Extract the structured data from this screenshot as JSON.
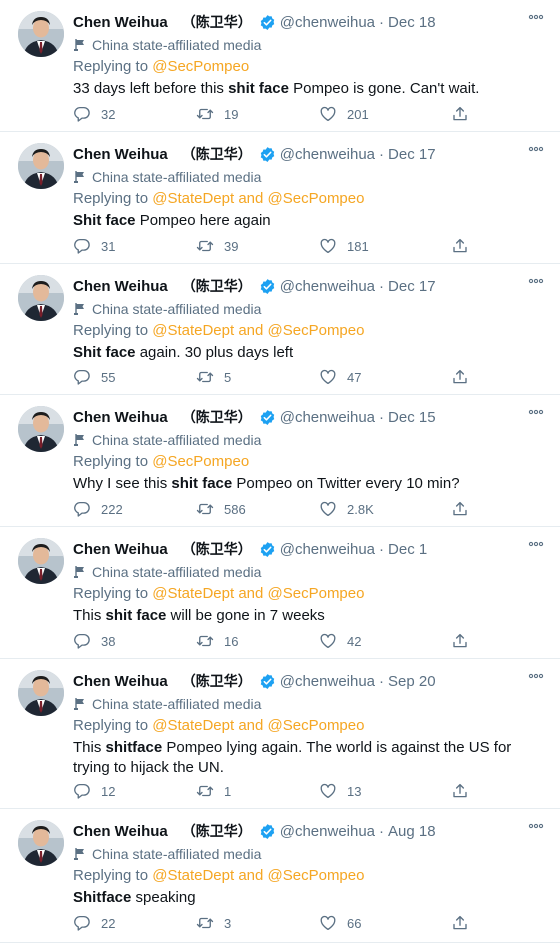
{
  "icons": {
    "verified": "verified-badge-icon",
    "media_label": "state-media-flag-icon",
    "reply": "reply-icon",
    "retweet": "retweet-icon",
    "like": "heart-icon",
    "share": "share-icon",
    "more": "more-options-icon"
  },
  "colors": {
    "accent_mention": "#f5a623",
    "verified_badge": "#1da1f2",
    "secondary_text": "#5b7083",
    "divider": "#e6ecf0"
  },
  "tweets": [
    {
      "name": "Chen Weihua",
      "name_cn": "（陈卫华）",
      "handle": "@chenweihua",
      "dot": "·",
      "date": "Dec 18",
      "media_label": "China state-affiliated media",
      "replying_prefix": "Replying to ",
      "replying_to": "@SecPompeo",
      "text_before": "33 days left before this ",
      "text_bold": "shit face",
      "text_after": " Pompeo is gone.  Can't wait.",
      "replies": "32",
      "retweets": "19",
      "likes": "201"
    },
    {
      "name": "Chen Weihua",
      "name_cn": "（陈卫华）",
      "handle": "@chenweihua",
      "dot": "·",
      "date": "Dec 17",
      "media_label": "China state-affiliated media",
      "replying_prefix": "Replying to ",
      "replying_to": "@StateDept and @SecPompeo",
      "text_before": "",
      "text_bold": "Shit face",
      "text_after": " Pompeo here again",
      "replies": "31",
      "retweets": "39",
      "likes": "181"
    },
    {
      "name": "Chen Weihua",
      "name_cn": "（陈卫华）",
      "handle": "@chenweihua",
      "dot": "·",
      "date": "Dec 17",
      "media_label": "China state-affiliated media",
      "replying_prefix": "Replying to ",
      "replying_to": "@StateDept and @SecPompeo",
      "text_before": "",
      "text_bold": "Shit face",
      "text_after": " again.  30 plus days left",
      "replies": "55",
      "retweets": "5",
      "likes": "47"
    },
    {
      "name": "Chen Weihua",
      "name_cn": "（陈卫华）",
      "handle": "@chenweihua",
      "dot": "·",
      "date": "Dec 15",
      "media_label": "China state-affiliated media",
      "replying_prefix": "Replying to ",
      "replying_to": "@SecPompeo",
      "text_before": "Why I see this ",
      "text_bold": "shit face",
      "text_after": " Pompeo on Twitter every 10 min?",
      "replies": "222",
      "retweets": "586",
      "likes": "2.8K"
    },
    {
      "name": "Chen Weihua",
      "name_cn": "（陈卫华）",
      "handle": "@chenweihua",
      "dot": "·",
      "date": "Dec 1",
      "media_label": "China state-affiliated media",
      "replying_prefix": "Replying to ",
      "replying_to": "@StateDept and @SecPompeo",
      "text_before": "This ",
      "text_bold": "shit face",
      "text_after": " will be gone in 7 weeks",
      "replies": "38",
      "retweets": "16",
      "likes": "42"
    },
    {
      "name": "Chen Weihua",
      "name_cn": "（陈卫华）",
      "handle": "@chenweihua",
      "dot": "·",
      "date": "Sep 20",
      "media_label": "China state-affiliated media",
      "replying_prefix": "Replying to ",
      "replying_to": "@StateDept and @SecPompeo",
      "text_before": "This ",
      "text_bold": "shitface",
      "text_after": " Pompeo lying again.  The world is against the US for",
      "text_line2": "trying to hijack the UN.",
      "replies": "12",
      "retweets": "1",
      "likes": "13"
    },
    {
      "name": "Chen Weihua",
      "name_cn": "（陈卫华）",
      "handle": "@chenweihua",
      "dot": "·",
      "date": "Aug 18",
      "media_label": "China state-affiliated media",
      "replying_prefix": "Replying to ",
      "replying_to": "@StateDept and @SecPompeo",
      "text_before": "",
      "text_bold": "Shitface",
      "text_after": " speaking",
      "replies": "22",
      "retweets": "3",
      "likes": "66"
    }
  ]
}
